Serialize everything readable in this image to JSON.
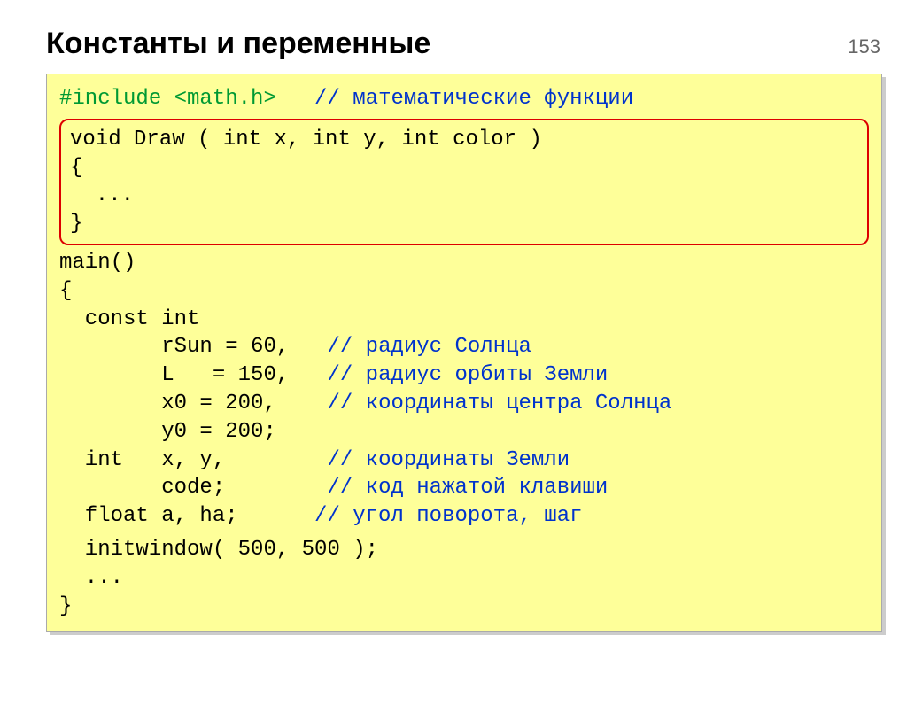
{
  "page_number": "153",
  "title": "Константы и переменные",
  "code": {
    "include_pre": "#include ",
    "include_header": "<math.h>",
    "include_comment": "   // математические функции",
    "box_line1": "void Draw ( int x, int y, int color )",
    "box_line2": "{",
    "box_line3": "  ...",
    "box_line4": "}",
    "main1": "main()",
    "main2": "{",
    "main3_a": "  const int",
    "main4_a": "        rSun = 60,   ",
    "main4_b": "// радиус Солнца",
    "main5_a": "        L   = 150,   ",
    "main5_b": "// радиус орбиты Земли",
    "main6_a": "        x0 = 200,    ",
    "main6_b": "// координаты центра Солнца",
    "main7_a": "        y0 = 200;",
    "main8_a": "  int   x, y,        ",
    "main8_b": "// координаты Земли",
    "main9_a": "        code;        ",
    "main9_b": "// код нажатой клавиши",
    "main10_a": "  float a, ha;      ",
    "main10_b": "// угол поворота, шаг",
    "main11": "  initwindow( 500, 500 );",
    "main12": "  ...",
    "main13": "}"
  }
}
